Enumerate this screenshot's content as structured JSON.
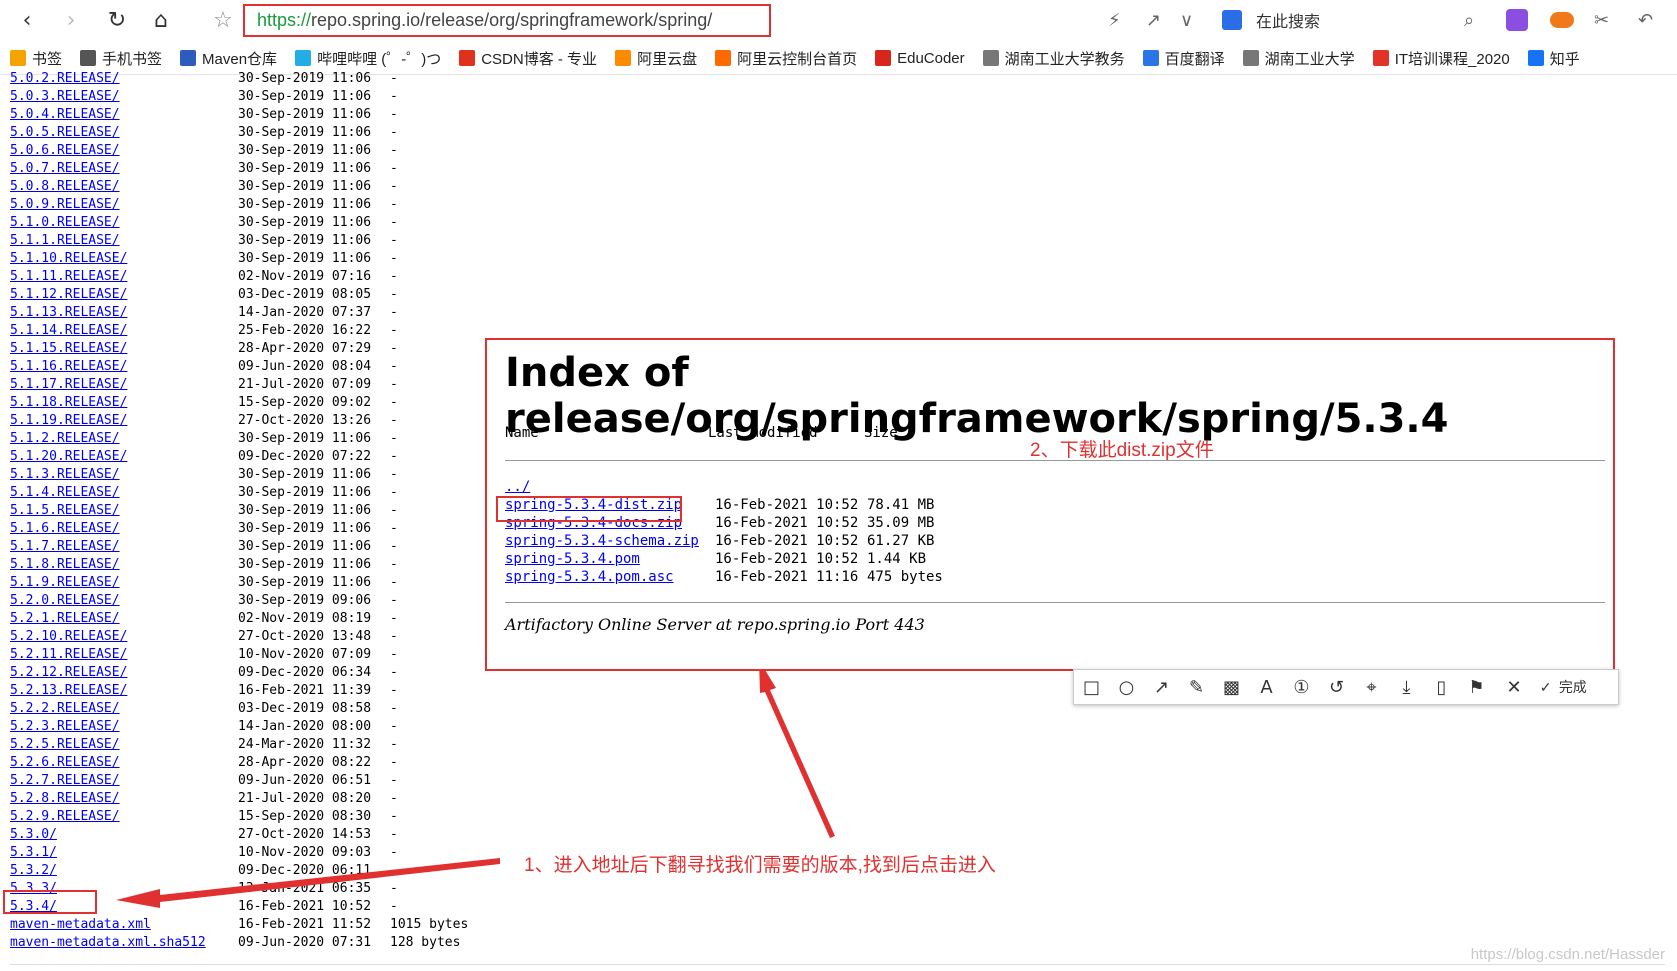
{
  "browser": {
    "url_scheme": "https://",
    "url_rest": "repo.spring.io/release/org/springframework/spring/",
    "search_placeholder": "在此搜索",
    "bookmarks": [
      {
        "label": "书签",
        "icon": "star-icon",
        "color": "#f5a300"
      },
      {
        "label": "手机书签",
        "icon": "phone-icon",
        "color": "#555555"
      },
      {
        "label": "Maven仓库",
        "icon": "mvn-icon",
        "color": "#2c5dbd"
      },
      {
        "label": "哔哩哔哩 (゜-゜)つ",
        "icon": "bilibili-icon",
        "color": "#23ade5"
      },
      {
        "label": "CSDN博客 - 专业",
        "icon": "csdn-icon",
        "color": "#e0301e"
      },
      {
        "label": "阿里云盘",
        "icon": "aliyun-drive-icon",
        "color": "#ff8a00"
      },
      {
        "label": "阿里云控制台首页",
        "icon": "aliyun-icon",
        "color": "#ff6a00"
      },
      {
        "label": "EduCoder",
        "icon": "educoder-icon",
        "color": "#d9261c"
      },
      {
        "label": "湖南工业大学教务",
        "icon": "globe-icon",
        "color": "#777777"
      },
      {
        "label": "百度翻译",
        "icon": "translate-icon",
        "color": "#2b74e8"
      },
      {
        "label": "湖南工业大学",
        "icon": "globe-icon",
        "color": "#777777"
      },
      {
        "label": "IT培训课程_2020",
        "icon": "it-icon",
        "color": "#e2322a"
      },
      {
        "label": "知乎",
        "icon": "zhihu-icon",
        "color": "#1772f6"
      }
    ]
  },
  "listing": [
    {
      "name": "5.0.2.RELEASE/",
      "date": "30-Sep-2019 11:06",
      "size": "-"
    },
    {
      "name": "5.0.3.RELEASE/",
      "date": "30-Sep-2019 11:06",
      "size": "-"
    },
    {
      "name": "5.0.4.RELEASE/",
      "date": "30-Sep-2019 11:06",
      "size": "-"
    },
    {
      "name": "5.0.5.RELEASE/",
      "date": "30-Sep-2019 11:06",
      "size": "-"
    },
    {
      "name": "5.0.6.RELEASE/",
      "date": "30-Sep-2019 11:06",
      "size": "-"
    },
    {
      "name": "5.0.7.RELEASE/",
      "date": "30-Sep-2019 11:06",
      "size": "-"
    },
    {
      "name": "5.0.8.RELEASE/",
      "date": "30-Sep-2019 11:06",
      "size": "-"
    },
    {
      "name": "5.0.9.RELEASE/",
      "date": "30-Sep-2019 11:06",
      "size": "-"
    },
    {
      "name": "5.1.0.RELEASE/",
      "date": "30-Sep-2019 11:06",
      "size": "-"
    },
    {
      "name": "5.1.1.RELEASE/",
      "date": "30-Sep-2019 11:06",
      "size": "-"
    },
    {
      "name": "5.1.10.RELEASE/",
      "date": "30-Sep-2019 11:06",
      "size": "-"
    },
    {
      "name": "5.1.11.RELEASE/",
      "date": "02-Nov-2019 07:16",
      "size": "-"
    },
    {
      "name": "5.1.12.RELEASE/",
      "date": "03-Dec-2019 08:05",
      "size": "-"
    },
    {
      "name": "5.1.13.RELEASE/",
      "date": "14-Jan-2020 07:37",
      "size": "-"
    },
    {
      "name": "5.1.14.RELEASE/",
      "date": "25-Feb-2020 16:22",
      "size": "-"
    },
    {
      "name": "5.1.15.RELEASE/",
      "date": "28-Apr-2020 07:29",
      "size": "-"
    },
    {
      "name": "5.1.16.RELEASE/",
      "date": "09-Jun-2020 08:04",
      "size": "-"
    },
    {
      "name": "5.1.17.RELEASE/",
      "date": "21-Jul-2020 07:09",
      "size": "-"
    },
    {
      "name": "5.1.18.RELEASE/",
      "date": "15-Sep-2020 09:02",
      "size": "-"
    },
    {
      "name": "5.1.19.RELEASE/",
      "date": "27-Oct-2020 13:26",
      "size": "-"
    },
    {
      "name": "5.1.2.RELEASE/",
      "date": "30-Sep-2019 11:06",
      "size": "-"
    },
    {
      "name": "5.1.20.RELEASE/",
      "date": "09-Dec-2020 07:22",
      "size": "-"
    },
    {
      "name": "5.1.3.RELEASE/",
      "date": "30-Sep-2019 11:06",
      "size": "-"
    },
    {
      "name": "5.1.4.RELEASE/",
      "date": "30-Sep-2019 11:06",
      "size": "-"
    },
    {
      "name": "5.1.5.RELEASE/",
      "date": "30-Sep-2019 11:06",
      "size": "-"
    },
    {
      "name": "5.1.6.RELEASE/",
      "date": "30-Sep-2019 11:06",
      "size": "-"
    },
    {
      "name": "5.1.7.RELEASE/",
      "date": "30-Sep-2019 11:06",
      "size": "-"
    },
    {
      "name": "5.1.8.RELEASE/",
      "date": "30-Sep-2019 11:06",
      "size": "-"
    },
    {
      "name": "5.1.9.RELEASE/",
      "date": "30-Sep-2019 11:06",
      "size": "-"
    },
    {
      "name": "5.2.0.RELEASE/",
      "date": "30-Sep-2019 09:06",
      "size": "-"
    },
    {
      "name": "5.2.1.RELEASE/",
      "date": "02-Nov-2019 08:19",
      "size": "-"
    },
    {
      "name": "5.2.10.RELEASE/",
      "date": "27-Oct-2020 13:48",
      "size": "-"
    },
    {
      "name": "5.2.11.RELEASE/",
      "date": "10-Nov-2020 07:09",
      "size": "-"
    },
    {
      "name": "5.2.12.RELEASE/",
      "date": "09-Dec-2020 06:34",
      "size": "-"
    },
    {
      "name": "5.2.13.RELEASE/",
      "date": "16-Feb-2021 11:39",
      "size": "-"
    },
    {
      "name": "5.2.2.RELEASE/",
      "date": "03-Dec-2019 08:58",
      "size": "-"
    },
    {
      "name": "5.2.3.RELEASE/",
      "date": "14-Jan-2020 08:00",
      "size": "-"
    },
    {
      "name": "5.2.5.RELEASE/",
      "date": "24-Mar-2020 11:32",
      "size": "-"
    },
    {
      "name": "5.2.6.RELEASE/",
      "date": "28-Apr-2020 08:22",
      "size": "-"
    },
    {
      "name": "5.2.7.RELEASE/",
      "date": "09-Jun-2020 06:51",
      "size": "-"
    },
    {
      "name": "5.2.8.RELEASE/",
      "date": "21-Jul-2020 08:20",
      "size": "-"
    },
    {
      "name": "5.2.9.RELEASE/",
      "date": "15-Sep-2020 08:30",
      "size": "-"
    },
    {
      "name": "5.3.0/",
      "date": "27-Oct-2020 14:53",
      "size": "-"
    },
    {
      "name": "5.3.1/",
      "date": "10-Nov-2020 09:03",
      "size": "-"
    },
    {
      "name": "5.3.2/",
      "date": "09-Dec-2020 06:11",
      "size": "-"
    },
    {
      "name": "5.3.3/",
      "date": "13-Jan-2021 06:35",
      "size": "-"
    },
    {
      "name": "5.3.4/",
      "date": "16-Feb-2021 10:52",
      "size": "-"
    },
    {
      "name": "maven-metadata.xml",
      "date": "16-Feb-2021 11:52",
      "size": "1015 bytes"
    },
    {
      "name": "maven-metadata.xml.sha512",
      "date": "09-Jun-2020 07:31",
      "size": "128 bytes"
    }
  ],
  "panel": {
    "title": "Index of release/org/springframework/spring/5.3.4",
    "col_name": "Name",
    "col_modified": "Last modified",
    "col_size": "Size",
    "parent": "../",
    "files": [
      {
        "name": "spring-5.3.4-dist.zip",
        "date": "16-Feb-2021 10:52",
        "size": "78.41 MB"
      },
      {
        "name": "spring-5.3.4-docs.zip",
        "date": "16-Feb-2021 10:52",
        "size": "35.09 MB"
      },
      {
        "name": "spring-5.3.4-schema.zip",
        "date": "16-Feb-2021 10:52",
        "size": "61.27 KB"
      },
      {
        "name": "spring-5.3.4.pom",
        "date": "16-Feb-2021 10:52",
        "size": "1.44 KB"
      },
      {
        "name": "spring-5.3.4.pom.asc",
        "date": "16-Feb-2021 11:16",
        "size": "475 bytes"
      }
    ],
    "footer": "Artifactory Online Server at repo.spring.io Port 443"
  },
  "snip_toolbar": {
    "done_label": "完成"
  },
  "annotations": {
    "step1": "1、进入地址后下翻寻找我们需要的版本,找到后点击进入",
    "step2": "2、下载此dist.zip文件"
  },
  "watermark": "https://blog.csdn.net/Hassder",
  "colors": {
    "annotation_red": "#e03030",
    "link_blue": "#0000ee",
    "url_green": "#1a9a3a"
  }
}
